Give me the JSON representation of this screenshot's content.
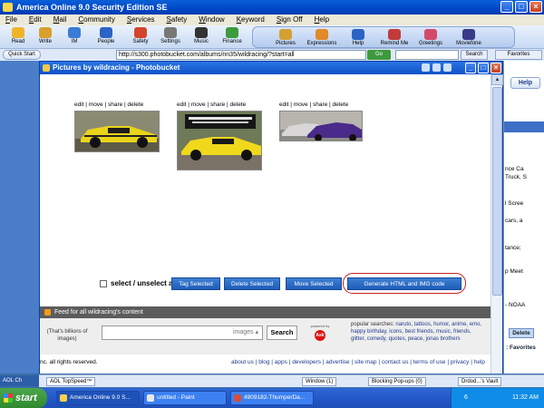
{
  "aol": {
    "title": "America Online 9.0 Security Edition SE",
    "menu": [
      "File",
      "Edit",
      "Mail",
      "Community",
      "Services",
      "Safety",
      "Window",
      "Keyword",
      "Sign Off",
      "Help"
    ],
    "toolbar_left": [
      {
        "label": "Read",
        "icon": "mail-icon",
        "color": "#f0b429"
      },
      {
        "label": "Write",
        "icon": "pencil-icon",
        "color": "#d9a02c"
      },
      {
        "label": "IM",
        "icon": "chat-icon",
        "color": "#3a7bd5"
      },
      {
        "label": "People",
        "icon": "people-icon",
        "color": "#2b64c6"
      },
      {
        "label": "Safety",
        "icon": "shield-icon",
        "color": "#d4442a"
      },
      {
        "label": "Settings",
        "icon": "gear-icon",
        "color": "#777"
      },
      {
        "label": "Music",
        "icon": "headphones-icon",
        "color": "#333"
      },
      {
        "label": "Finance",
        "icon": "money-icon",
        "color": "#3d9a3d"
      }
    ],
    "toolbar_right": [
      {
        "label": "Pictures",
        "icon": "camera-icon",
        "color": "#d3a133"
      },
      {
        "label": "Expressions",
        "icon": "smiley-icon",
        "color": "#e08a2a"
      },
      {
        "label": "Help",
        "icon": "help-icon",
        "color": "#2b64c6"
      },
      {
        "label": "Remind Me",
        "icon": "bell-icon",
        "color": "#c23b3b"
      },
      {
        "label": "Greetings",
        "icon": "card-icon",
        "color": "#d34b6a"
      },
      {
        "label": "Moviefone",
        "icon": "film-icon",
        "color": "#3a3a8c"
      }
    ],
    "quick_start": "Quick Start",
    "address_url": "http://s300.photobucket.com/albums/nn35/wildracing/?start=all",
    "go_label": "Go",
    "search_label": "Search",
    "favorites_label": "Favorites",
    "help_label": "Help",
    "right_panel_lines": [
      "nce Ca",
      "Truck, S",
      "l Scree",
      "cars, a",
      "tance;",
      "p Meet",
      "- NOAA"
    ],
    "delete_label": "Delete",
    "favorites_text": ": Favorites",
    "chat_tab": "AOL Ch",
    "lower_bar": [
      "AOL TopSpeed™",
      "Window (1)",
      "Blocking Pop-ups (0)",
      "Drdod...'s Vault"
    ]
  },
  "inner": {
    "title": "Pictures by wildracing - Photobucket",
    "photos": [
      {
        "actions": "edit | move | share | delete",
        "alt": "yellow muscle car"
      },
      {
        "actions": "edit | move | share | delete",
        "alt": "yellow car with banner"
      },
      {
        "actions": "edit | move | share | delete",
        "alt": "purple car in lot"
      }
    ],
    "select_label": "select / unselect all",
    "buttons": {
      "tag": "Tag Selected",
      "delete": "Delete Selected",
      "move": "Move Selected",
      "generate": "Generate HTML and IMG code"
    },
    "feed_text": "Feed for all wildracing's content",
    "search_note": "(That's billions of images)",
    "images_placeholder": "images ▴",
    "search_button": "Search",
    "powered_by": "powered by",
    "ask_logo": "Ask",
    "popular_label": "popular searches:",
    "popular_terms": "naruto, tattoos, humor, anime, emo, happy birthday, icons, best friends, music, friends, glitter, comedy, quotes, peace, jonas brothers",
    "rights": "nc. all rights reserved.",
    "footer_links": "about us | blog | apps | developers | advertise | site map | contact us | terms of use | privacy | help"
  },
  "taskbar": {
    "start": "start",
    "tasks": [
      "America Online 9.0 S...",
      "untitled - Paint",
      "4909182-ThumperDa..."
    ],
    "tray_num": "6",
    "time": "11:32 AM"
  }
}
